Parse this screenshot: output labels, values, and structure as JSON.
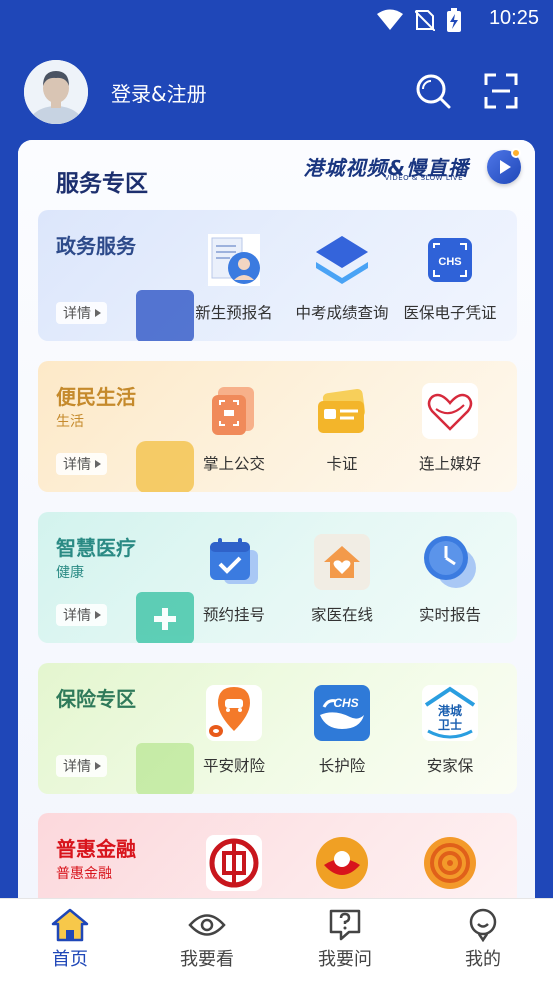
{
  "status_bar": {
    "time": "10:25",
    "icons": [
      "wifi-icon",
      "no-sim-icon",
      "battery-charging-icon"
    ]
  },
  "header": {
    "login_text": "登录&注册",
    "icons": [
      "search-icon",
      "scan-icon"
    ]
  },
  "service_area": {
    "title": "服务专区",
    "banner_text": "港城视频&慢直播",
    "banner_subtext": "VIDEO & SLOW LIVE"
  },
  "detail_label": "详情",
  "cards": [
    {
      "title": "政务服务",
      "subtitle": "",
      "services": [
        {
          "label": "新生预报名",
          "icon": "enrollment-icon"
        },
        {
          "label": "中考成绩查询",
          "icon": "layers-icon"
        },
        {
          "label": "医保电子凭证",
          "icon": "chs-code-icon"
        }
      ]
    },
    {
      "title": "便民生活",
      "subtitle": "生活",
      "services": [
        {
          "label": "掌上公交",
          "icon": "bus-card-icon"
        },
        {
          "label": "卡证",
          "icon": "id-card-icon"
        },
        {
          "label": "连上媒好",
          "icon": "heart-logo-icon"
        }
      ]
    },
    {
      "title": "智慧医疗",
      "subtitle": "健康",
      "services": [
        {
          "label": "预约挂号",
          "icon": "calendar-check-icon"
        },
        {
          "label": "家医在线",
          "icon": "home-heart-icon"
        },
        {
          "label": "实时报告",
          "icon": "clock-icon"
        }
      ]
    },
    {
      "title": "保险专区",
      "subtitle": "",
      "services": [
        {
          "label": "平安财险",
          "icon": "car-insurance-icon"
        },
        {
          "label": "长护险",
          "icon": "chs-hand-icon"
        },
        {
          "label": "安家保",
          "icon": "guard-house-icon"
        }
      ]
    },
    {
      "title": "普惠金融",
      "subtitle": "普惠金融",
      "services": [
        {
          "label": "",
          "icon": "icbc-bank-icon"
        },
        {
          "label": "",
          "icon": "bank-logo-icon"
        },
        {
          "label": "",
          "icon": "coin-pattern-icon"
        }
      ]
    }
  ],
  "bottom_nav": [
    {
      "label": "首页",
      "icon": "home-icon",
      "active": true
    },
    {
      "label": "我要看",
      "icon": "eye-icon",
      "active": false
    },
    {
      "label": "我要问",
      "icon": "question-icon",
      "active": false
    },
    {
      "label": "我的",
      "icon": "profile-icon",
      "active": false
    }
  ],
  "colors": {
    "brand_blue": "#1f47b8",
    "gov_title": "#2d4a8a",
    "life_title": "#c58a2c",
    "medical_title": "#2a8a84",
    "insurance_title": "#2f7a5a",
    "finance_title": "#d8141c"
  }
}
